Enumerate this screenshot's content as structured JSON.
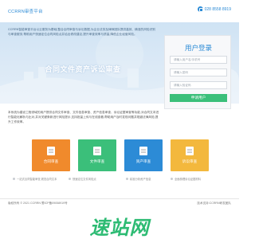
{
  "header": {
    "brand": "CCRRN审查平台",
    "phone": "028 8558 8919"
  },
  "banner": {
    "intro": "CCRRN智能审查平台以云服务为基础,整合合同审查与诉讼数据,为企业法务及律师团队提供高效、精准的风险识别与审查服务,帮助用户快速定位合同风险点并给出修改建议,提升审查效率与质量,降低企业经营风险。",
    "hero_title": "合同文件资产诉讼审查"
  },
  "login": {
    "title": "用户登录",
    "username_placeholder": "请输入用户名/手机号",
    "password_placeholder": "请输入密码",
    "code_placeholder": "请输入验证码",
    "button": "申请用户"
  },
  "section": {
    "description": "本系统为建设工程领域的用户提供合同文件审查、文件信息审查、资产信息审查、诉讼证据审查等功能,对合同文本进行智能化解析与比对,并对关键条款进行风险提示,支持批量上传与在线查看,帮助用户及时发现问题并规避法律风险,提升工作效率。"
  },
  "cards": [
    {
      "label": "合同审查",
      "color": "#f08a2c"
    },
    {
      "label": "文件审查",
      "color": "#3bbf7a"
    },
    {
      "label": "资产审查",
      "color": "#2c8bd6"
    },
    {
      "label": "诉讼审查",
      "color": "#f3b83d"
    }
  ],
  "features": [
    "一站式合同智能审查,规范合同文本",
    "快速定位文件风险点",
    "精准分析资产信息",
    "全面梳理诉讼证据材料"
  ],
  "footer": {
    "copyright": "版权所有 © 2021 CCRRN 蜀ICP备09058919号",
    "support": "技术支持:CCRRN研发团队"
  },
  "watermark": {
    "text": "速站网"
  }
}
